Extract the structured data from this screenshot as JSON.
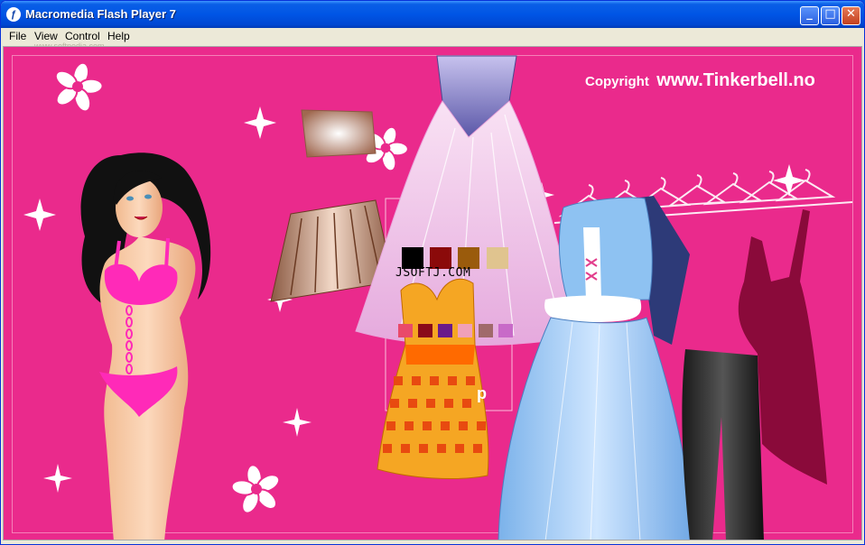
{
  "window": {
    "title": "Macromedia Flash Player 7",
    "app_icon": "flash-icon",
    "minimize": "_",
    "maximize": "□",
    "close": "✕"
  },
  "menu": {
    "items": [
      "File",
      "View",
      "Control",
      "Help"
    ]
  },
  "watermarks": {
    "top": "www.softpedia.com",
    "middle": "JSOFTJ.COM"
  },
  "game": {
    "copyright_prefix": "Copyright",
    "copyright_site": "www.Tinkerbell.no",
    "partial_letter": "p",
    "background_color": "#ea2a8c",
    "color_swatches_row1": [
      "#000000",
      "#8b0a0a",
      "#9a5b0c",
      "#e0c48f"
    ],
    "color_swatches_row2": [
      "#e94a6a",
      "#8a0a1a",
      "#6a1a8a",
      "#f0a0b8",
      "#a06a6a",
      "#c86ac8"
    ]
  }
}
